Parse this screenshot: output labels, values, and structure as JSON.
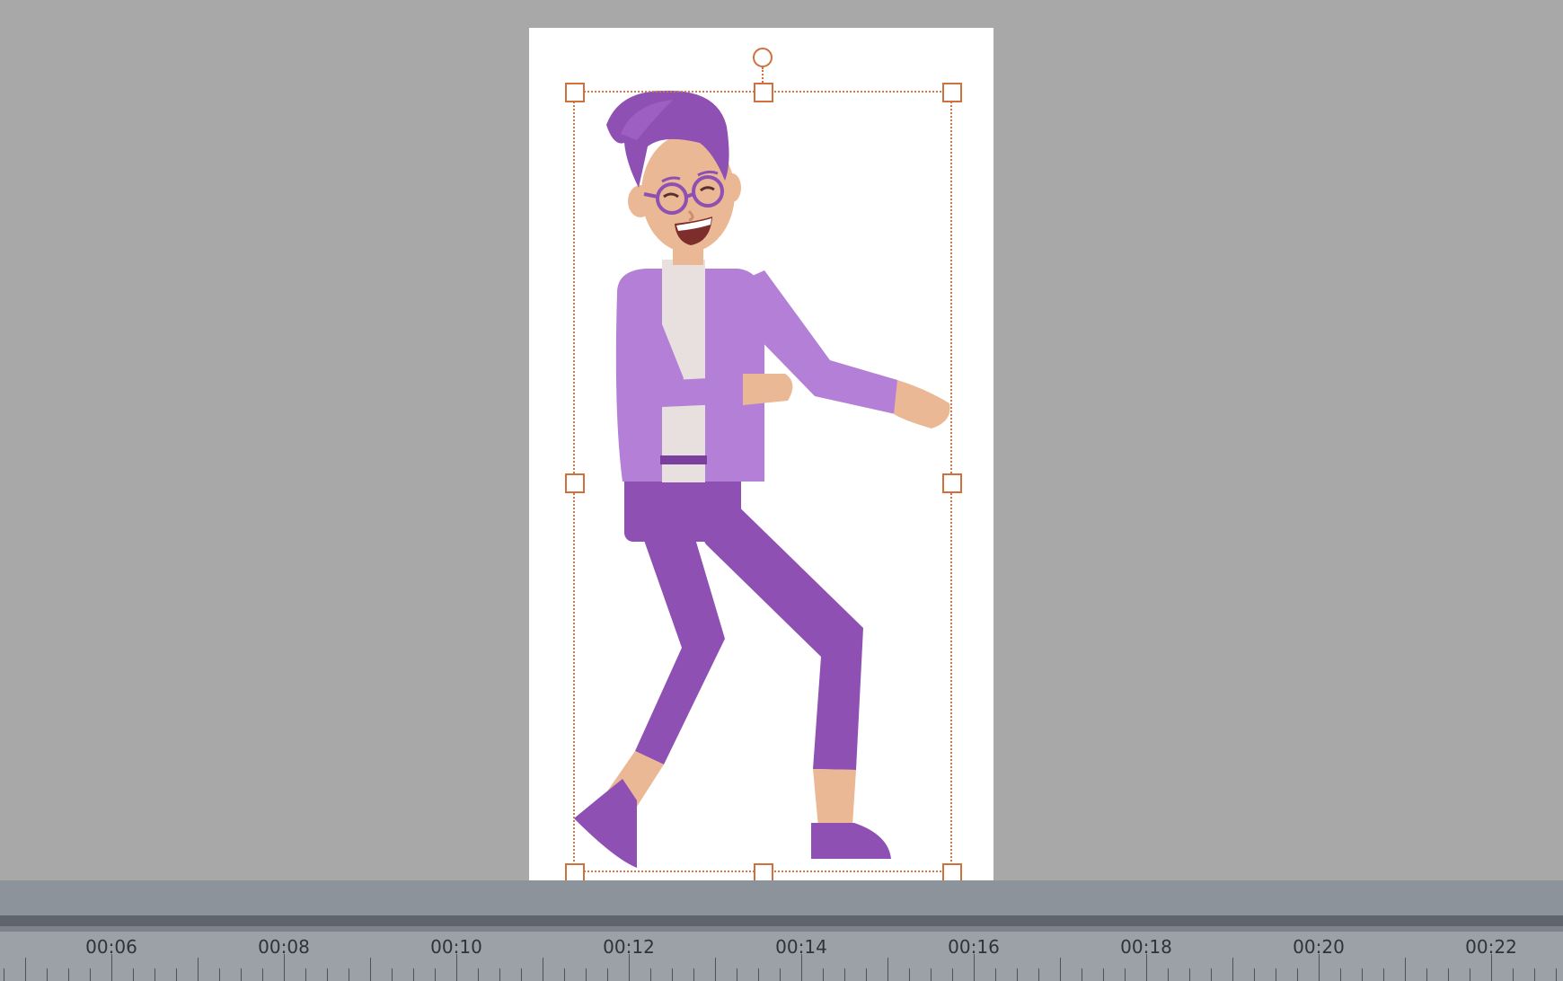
{
  "timeline": {
    "labels": [
      "00:06",
      "00:08",
      "00:10",
      "00:12",
      "00:14",
      "00:16",
      "00:18",
      "00:20",
      "00:22"
    ]
  },
  "colors": {
    "workspace_bg": "#a8a8a8",
    "canvas_bg": "#ffffff",
    "selection": "#d0703c",
    "suit": "#b47fd6",
    "pants": "#8e50b3",
    "skin": "#ebb896",
    "shirt": "#e8dfdf",
    "hair": "#8e50b3"
  },
  "icons": [
    "rotate-handle-icon",
    "resize-handle-icon"
  ]
}
